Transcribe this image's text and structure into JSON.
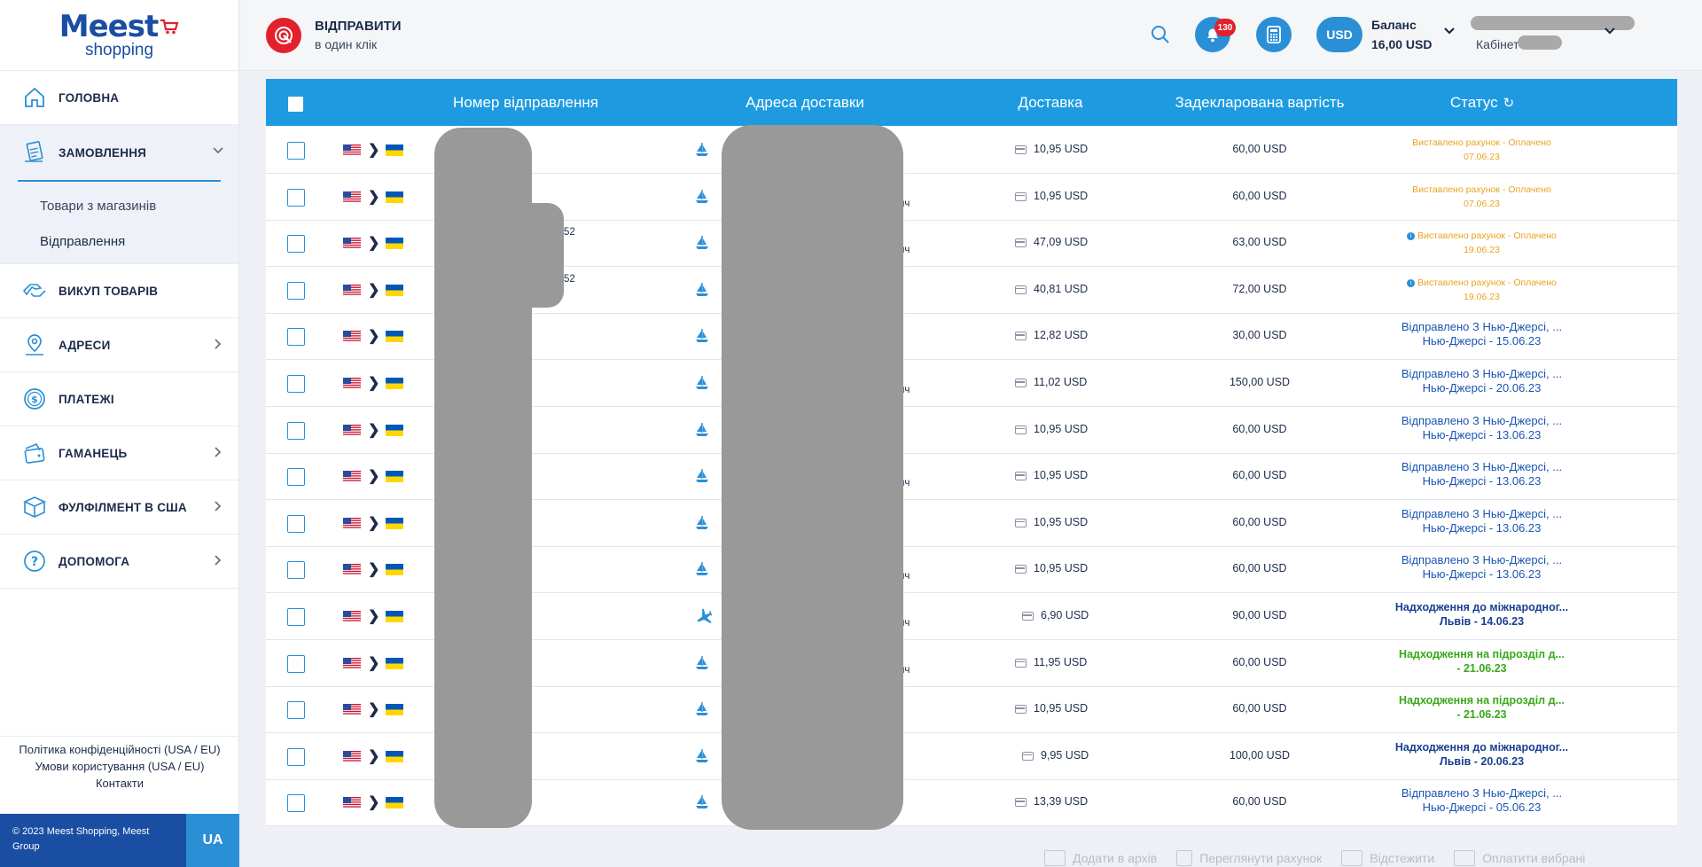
{
  "brand": {
    "logo_main": "Meest",
    "logo_sub": "shopping"
  },
  "sidebar": {
    "items": [
      {
        "label": "ГОЛОВНА",
        "icon": "home-icon",
        "expandable": false
      },
      {
        "label": "ЗАМОВЛЕННЯ",
        "icon": "orders-icon",
        "expandable": true,
        "expanded": true
      },
      {
        "label": "ВИКУП ТОВАРІВ",
        "icon": "buyout-icon",
        "expandable": false
      },
      {
        "label": "АДРЕСИ",
        "icon": "location-icon",
        "expandable": true
      },
      {
        "label": "ПЛАТЕЖІ",
        "icon": "dollar-icon",
        "expandable": false
      },
      {
        "label": "ГАМАНЕЦЬ",
        "icon": "wallet-icon",
        "expandable": true
      },
      {
        "label": "ФУЛФІЛМЕНТ В США",
        "icon": "box-icon",
        "expandable": true
      },
      {
        "label": "ДОПОМОГА",
        "icon": "help-icon",
        "expandable": true
      }
    ],
    "sub_items": [
      "Товари з магазинів",
      "Відправлення"
    ],
    "active_sub": "Відправлення",
    "footer_links": [
      "Політика конфіденційності (USA / EU)",
      "Умови користування (USA / EU)",
      "Контакти"
    ],
    "copyright": "© 2023 Meest Shopping, Meest Group",
    "language": "UA"
  },
  "header": {
    "send_title": "ВІДПРАВИТИ",
    "send_subtitle": "в один клік",
    "notifications_count": "130",
    "currency": "USD",
    "balance_label": "Баланс",
    "balance_value": "16,00 USD",
    "cabinet_label": "Кабінет"
  },
  "table": {
    "columns": [
      "Номер відправлення",
      "Адреса доставки",
      "Доставка",
      "Задекларована вартість",
      "Статус"
    ],
    "rows": [
      {
        "mode": "ship",
        "delivery": "10,95 USD",
        "declared": "60,00 USD",
        "status_type": "orange",
        "status_info": false,
        "status_line1": "Виставлено рахунок - Оплачено",
        "status_line2": "07.06.23",
        "frag": ""
      },
      {
        "mode": "ship",
        "delivery": "10,95 USD",
        "declared": "60,00 USD",
        "status_type": "orange",
        "status_info": false,
        "status_line1": "Виставлено рахунок - Оплачено",
        "status_line2": "07.06.23",
        "frag": "ич"
      },
      {
        "mode": "ship",
        "delivery": "47,09 USD",
        "declared": "63,00 USD",
        "status_type": "orange",
        "status_info": true,
        "status_line1": "Виставлено рахунок - Оплачено",
        "status_line2": "19.06.23",
        "frag": "ич",
        "num_frag": "52"
      },
      {
        "mode": "ship",
        "delivery": "40,81 USD",
        "declared": "72,00 USD",
        "status_type": "orange",
        "status_info": true,
        "status_line1": "Виставлено рахунок - Оплачено",
        "status_line2": "19.06.23",
        "frag": "",
        "num_frag": "52"
      },
      {
        "mode": "ship",
        "delivery": "12,82 USD",
        "declared": "30,00 USD",
        "status_type": "blue",
        "status_info": false,
        "status_line1": "Відправлено З Нью-Джерсі, ...",
        "status_line2": "Нью-Джерсі - 15.06.23",
        "frag": ""
      },
      {
        "mode": "ship",
        "delivery": "11,02 USD",
        "declared": "150,00 USD",
        "status_type": "blue",
        "status_info": false,
        "status_line1": "Відправлено З Нью-Джерсі, ...",
        "status_line2": "Нью-Джерсі - 20.06.23",
        "frag": "ич"
      },
      {
        "mode": "ship",
        "delivery": "10,95 USD",
        "declared": "60,00 USD",
        "status_type": "blue",
        "status_info": false,
        "status_line1": "Відправлено З Нью-Джерсі, ...",
        "status_line2": "Нью-Джерсі - 13.06.23",
        "frag": ""
      },
      {
        "mode": "ship",
        "delivery": "10,95 USD",
        "declared": "60,00 USD",
        "status_type": "blue",
        "status_info": false,
        "status_line1": "Відправлено З Нью-Джерсі, ...",
        "status_line2": "Нью-Джерсі - 13.06.23",
        "frag": "ич"
      },
      {
        "mode": "ship",
        "delivery": "10,95 USD",
        "declared": "60,00 USD",
        "status_type": "blue",
        "status_info": false,
        "status_line1": "Відправлено З Нью-Джерсі, ...",
        "status_line2": "Нью-Джерсі - 13.06.23",
        "frag": ""
      },
      {
        "mode": "ship",
        "delivery": "10,95 USD",
        "declared": "60,00 USD",
        "status_type": "blue",
        "status_info": false,
        "status_line1": "Відправлено З Нью-Джерсі, ...",
        "status_line2": "Нью-Джерсі - 13.06.23",
        "frag": "ич"
      },
      {
        "mode": "plane",
        "delivery": "6,90 USD",
        "declared": "90,00 USD",
        "status_type": "navy",
        "status_info": false,
        "status_line1": "Надходження до міжнародног...",
        "status_line2": "Львів - 14.06.23",
        "frag": "ич"
      },
      {
        "mode": "ship",
        "delivery": "11,95 USD",
        "declared": "60,00 USD",
        "status_type": "green",
        "status_info": false,
        "status_line1": "Надходження на підрозділ д...",
        "status_line2": "- 21.06.23",
        "frag": "ич"
      },
      {
        "mode": "ship",
        "delivery": "10,95 USD",
        "declared": "60,00 USD",
        "status_type": "green",
        "status_info": false,
        "status_line1": "Надходження на підрозділ д...",
        "status_line2": "- 21.06.23",
        "frag": ""
      },
      {
        "mode": "ship",
        "delivery": "9,95 USD",
        "declared": "100,00 USD",
        "status_type": "navy",
        "status_info": false,
        "status_line1": "Надходження до міжнародног...",
        "status_line2": "Львів - 20.06.23",
        "frag": ""
      },
      {
        "mode": "ship",
        "delivery": "13,39 USD",
        "declared": "60,00 USD",
        "status_type": "blue",
        "status_info": false,
        "status_line1": "Відправлено З Нью-Джерсі, ...",
        "status_line2": "Нью-Джерсі - 05.06.23",
        "frag": ""
      }
    ]
  },
  "bottom_actions": [
    "Додати в архів",
    "Переглянути рахунок",
    "Відстежити",
    "Оплатити вибрані"
  ],
  "colors": {
    "accent": "#1e9be0",
    "brand_blue": "#1a4ea2",
    "brand_red": "#e2212b",
    "status_orange": "#e8a31d",
    "status_blue": "#1a56b3",
    "status_green": "#39a81a"
  }
}
